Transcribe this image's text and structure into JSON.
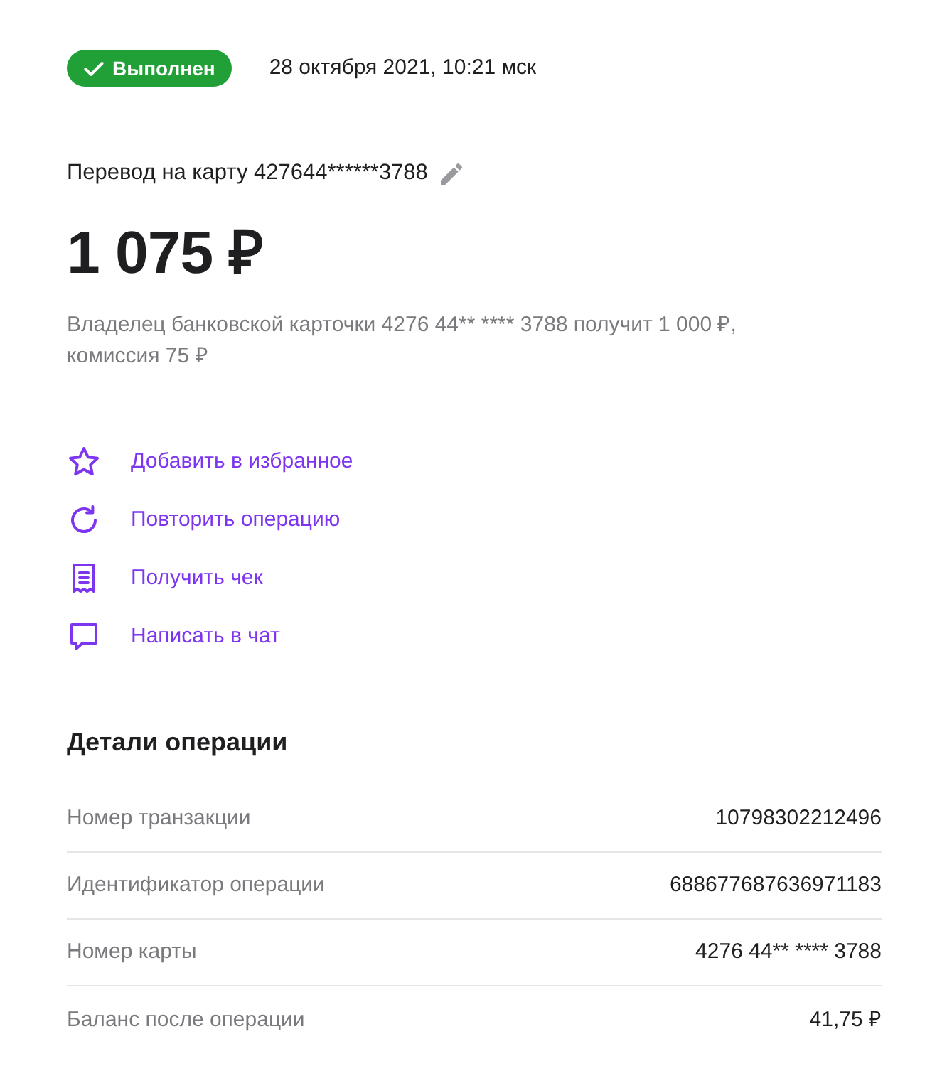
{
  "status": {
    "label": "Выполнен",
    "date": "28 октября 2021, 10:21 мск"
  },
  "transfer": {
    "title": "Перевод на карту 427644******3788",
    "amount": "1 075 ₽",
    "description": "Владелец банковской карточки 4276 44** **** 3788 получит 1 000 ₽, комиссия 75 ₽"
  },
  "actions": [
    {
      "label": "Добавить в избранное"
    },
    {
      "label": "Повторить операцию"
    },
    {
      "label": "Получить чек"
    },
    {
      "label": "Написать в чат"
    }
  ],
  "details": {
    "title": "Детали операции",
    "rows": [
      {
        "label": "Номер транзакции",
        "value": "10798302212496"
      },
      {
        "label": "Идентификатор операции",
        "value": "688677687636971183"
      },
      {
        "label": "Номер карты",
        "value": "4276 44** **** 3788"
      },
      {
        "label": "Баланс после операции",
        "value": "41,75 ₽"
      }
    ]
  }
}
